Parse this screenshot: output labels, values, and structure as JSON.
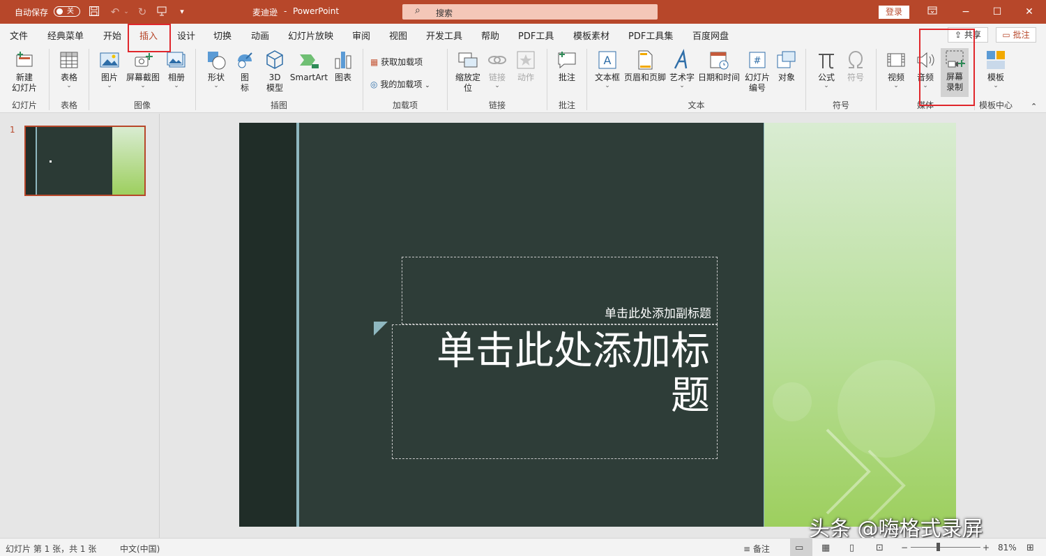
{
  "titlebar": {
    "autosave_label": "自动保存",
    "autosave_state": "关",
    "doc_name": "麦迪逊",
    "separator": "-",
    "app_name": "PowerPoint",
    "search_placeholder": "搜索",
    "login_label": "登录"
  },
  "tabs": [
    "文件",
    "经典菜单",
    "开始",
    "插入",
    "设计",
    "切换",
    "动画",
    "幻灯片放映",
    "审阅",
    "视图",
    "开发工具",
    "帮助",
    "PDF工具",
    "模板素材",
    "PDF工具集",
    "百度网盘"
  ],
  "active_tab": "插入",
  "share_label": "共享",
  "comments_label": "批注",
  "ribbon": {
    "groups": {
      "slides": "幻灯片",
      "tables": "表格",
      "images": "图像",
      "illustrations": "插图",
      "addins": "加载项",
      "links": "链接",
      "comments": "批注",
      "text": "文本",
      "symbols": "符号",
      "media": "媒体",
      "templates": "模板中心"
    },
    "buttons": {
      "new_slide": [
        "新建",
        "幻灯片"
      ],
      "table": "表格",
      "picture": "图片",
      "screenshot": "屏幕截图",
      "album": "相册",
      "shapes": "形状",
      "icons": [
        "图",
        "标"
      ],
      "model3d": [
        "3D",
        "模型"
      ],
      "smartart": "SmartArt",
      "chart": "图表",
      "get_addins": "获取加载项",
      "my_addins": "我的加载项",
      "zoom": [
        "缩放定",
        "位"
      ],
      "link": "链接",
      "action": "动作",
      "comment": "批注",
      "textbox": "文本框",
      "header_footer": "页眉和页脚",
      "wordart": "艺术字",
      "datetime": "日期和时间",
      "slide_number": [
        "幻灯片",
        "编号"
      ],
      "object": "对象",
      "equation": "公式",
      "symbol": "符号",
      "video": "视频",
      "audio": "音频",
      "screen_recording": [
        "屏幕",
        "录制"
      ],
      "template": "模板"
    }
  },
  "slides_pane": {
    "slide_number": "1"
  },
  "slide": {
    "subtitle_placeholder": "单击此处添加副标题",
    "title_placeholder": "单击此处添加标题"
  },
  "statusbar": {
    "slide_info": "幻灯片 第 1 张，共 1 张",
    "language": "中文(中国)",
    "notes": "备注",
    "zoom_minus": "−",
    "zoom_plus": "+",
    "zoom": "81%"
  },
  "watermark": "头条 @嗨格式录屏",
  "colors": {
    "accent": "#b7472a",
    "highlight": "#e0262b",
    "slide_bg": "#2e3d38"
  }
}
